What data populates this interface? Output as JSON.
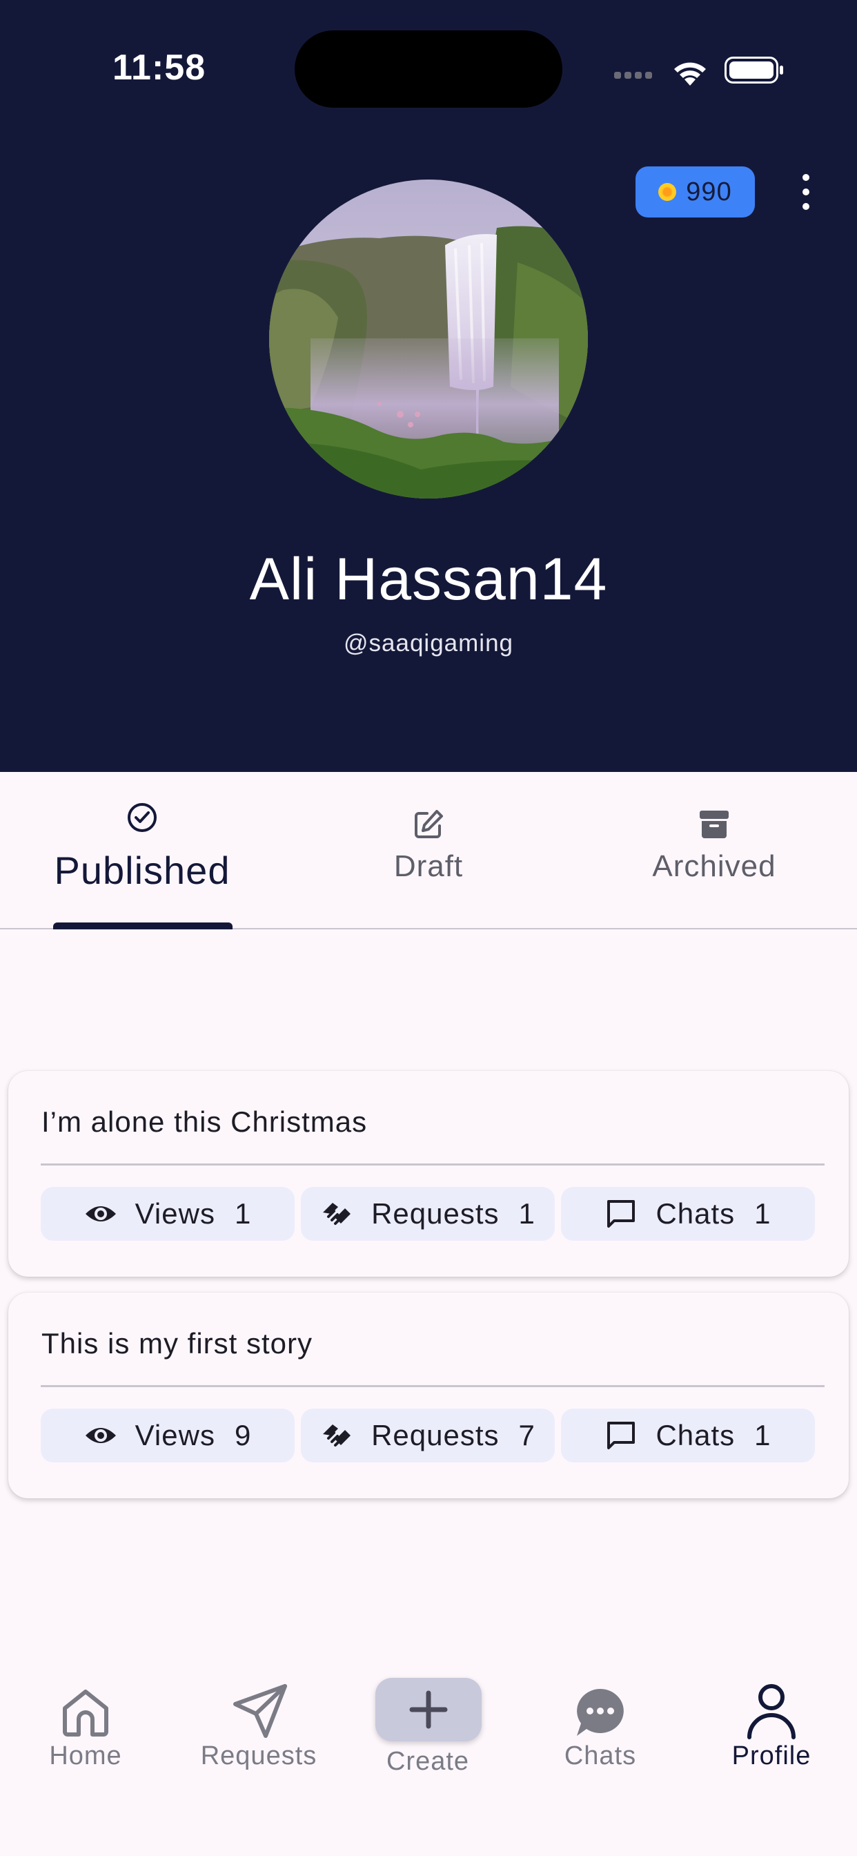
{
  "status_bar": {
    "time": "11:58",
    "signal_icon": "cellular-signal-icon",
    "wifi_icon": "wifi-icon",
    "battery_icon": "battery-icon"
  },
  "header": {
    "background_color": "#141838",
    "coins": {
      "icon": "coin-icon",
      "value": "990",
      "badge_color": "#3e82f7"
    },
    "menu_icon": "more-vertical-icon",
    "avatar_icon": "waterfall-avatar-image",
    "name": "Ali Hassan14",
    "handle": "@saaqigaming"
  },
  "tabs": [
    {
      "label": "Published",
      "icon": "check-circle-icon",
      "selected": true
    },
    {
      "label": "Draft",
      "icon": "edit-icon",
      "selected": false
    },
    {
      "label": "Archived",
      "icon": "archive-box-icon",
      "selected": false
    }
  ],
  "stories": [
    {
      "title": "I’m alone this Christmas",
      "stats": [
        {
          "label": "Views",
          "count": "1",
          "icon": "eye-icon"
        },
        {
          "label": "Requests",
          "count": "1",
          "icon": "handshake-icon"
        },
        {
          "label": "Chats",
          "count": "1",
          "icon": "chat-bubble-icon"
        }
      ]
    },
    {
      "title": "This is my first story",
      "stats": [
        {
          "label": "Views",
          "count": "9",
          "icon": "eye-icon"
        },
        {
          "label": "Requests",
          "count": "7",
          "icon": "handshake-icon"
        },
        {
          "label": "Chats",
          "count": "1",
          "icon": "chat-bubble-icon"
        }
      ]
    }
  ],
  "bottom_nav": [
    {
      "label": "Home",
      "icon": "home-icon",
      "active": false
    },
    {
      "label": "Requests",
      "icon": "send-icon",
      "active": false
    },
    {
      "label": "Create",
      "icon": "plus-icon",
      "active": false
    },
    {
      "label": "Chats",
      "icon": "chat-dots-icon",
      "active": false
    },
    {
      "label": "Profile",
      "icon": "person-icon",
      "active": true
    }
  ]
}
